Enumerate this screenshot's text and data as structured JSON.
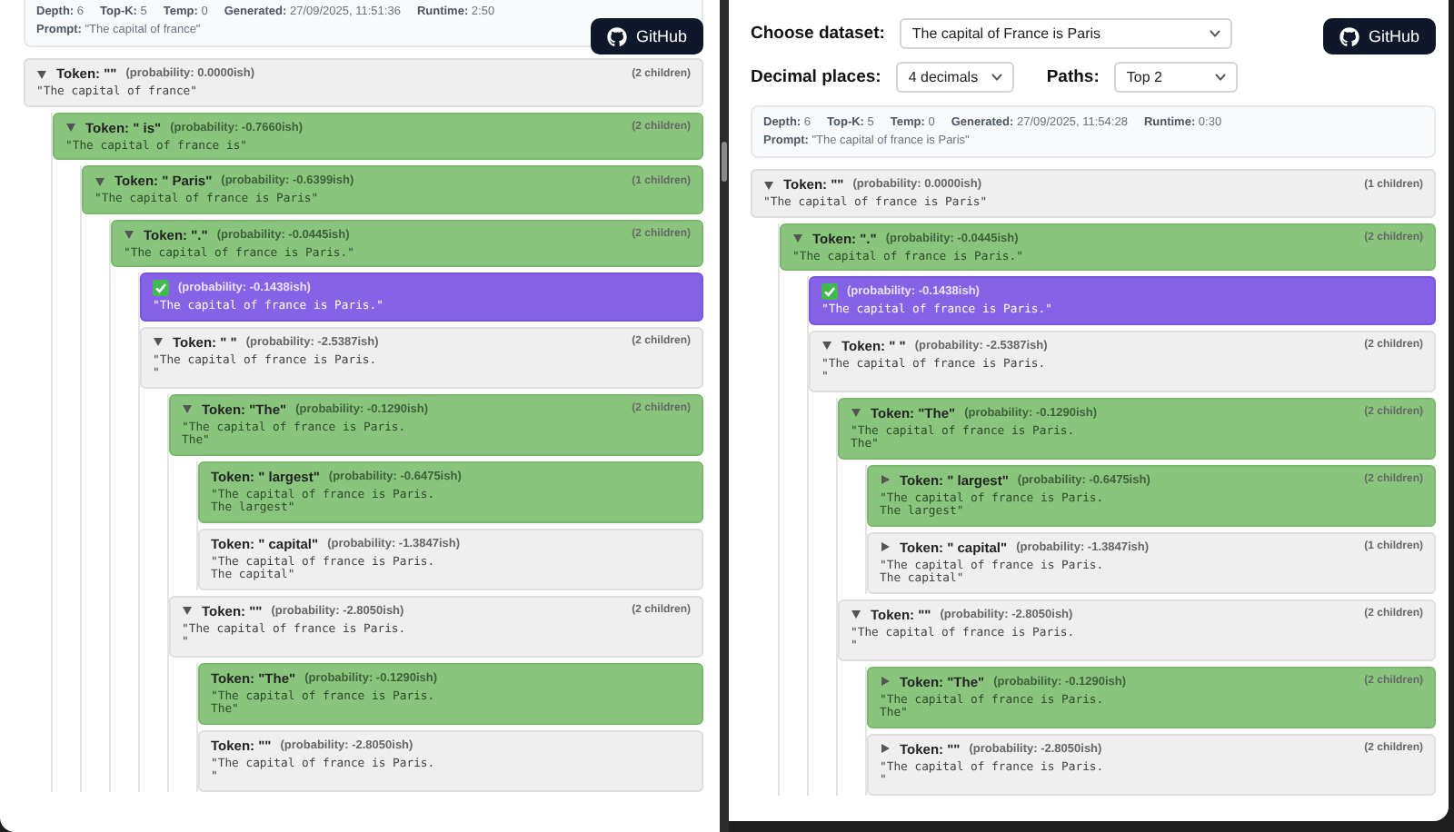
{
  "left": {
    "info": {
      "stats": [
        "**Depth:** 6",
        "**Top-K:** 5",
        "**Temp:** 0",
        "**Generated:** 27/09/2025, 11:51:36",
        "**Runtime:** 2:50"
      ],
      "prompt": "**Prompt:** \"The capital of france\""
    },
    "github_button": "GitHub",
    "tree": {
      "kind": "token",
      "label": "Token: \"\"",
      "probability": "(probability: 0.0000ish)",
      "children_count": "(2 children)",
      "text": "\"The capital of france\"",
      "highlighted": false,
      "expanded": true,
      "children": [
        {
          "kind": "token",
          "label": "Token: \" is\"",
          "probability": "(probability: -0.7660ish)",
          "children_count": "(2 children)",
          "text": "\"The capital of france is\"",
          "highlighted": true,
          "expanded": true,
          "children": [
            {
              "kind": "token",
              "label": "Token: \" Paris\"",
              "probability": "(probability: -0.6399ish)",
              "children_count": "(1 children)",
              "text": "\"The capital of france is Paris\"",
              "highlighted": true,
              "expanded": true,
              "children": [
                {
                  "kind": "token",
                  "label": "Token: \".\"",
                  "probability": "(probability: -0.0445ish)",
                  "children_count": "(2 children)",
                  "text": "\"The capital of france is Paris.\"",
                  "highlighted": true,
                  "expanded": true,
                  "children": [
                    {
                      "kind": "final",
                      "probability": "(probability: -0.1438ish)",
                      "text": "\"The capital of france is Paris.\""
                    },
                    {
                      "kind": "token",
                      "label": "Token: \" \"",
                      "probability": "(probability: -2.5387ish)",
                      "children_count": "(2 children)",
                      "text": "\"The capital of france is Paris.\n\"",
                      "highlighted": false,
                      "expanded": true,
                      "children": [
                        {
                          "kind": "token",
                          "label": "Token: \"The\"",
                          "probability": "(probability: -0.1290ish)",
                          "children_count": "(2 children)",
                          "text": "\"The capital of france is Paris.\nThe\"",
                          "highlighted": true,
                          "expanded": true,
                          "children": [
                            {
                              "kind": "token",
                              "label": "Token: \" largest\"",
                              "probability": "(probability: -0.6475ish)",
                              "text": "\"The capital of france is Paris.\nThe largest\"",
                              "highlighted": true
                            },
                            {
                              "kind": "token",
                              "label": "Token: \" capital\"",
                              "probability": "(probability: -1.3847ish)",
                              "text": "\"The capital of france is Paris.\nThe capital\"",
                              "highlighted": false
                            }
                          ]
                        },
                        {
                          "kind": "token",
                          "label": "Token: \"\"",
                          "probability": "(probability: -2.8050ish)",
                          "children_count": "(2 children)",
                          "text": "\"The capital of france is Paris.\n\"",
                          "highlighted": false,
                          "expanded": true,
                          "children": [
                            {
                              "kind": "token",
                              "label": "Token: \"The\"",
                              "probability": "(probability: -0.1290ish)",
                              "text": "\"The capital of france is Paris.\nThe\"",
                              "highlighted": true
                            },
                            {
                              "kind": "token",
                              "label": "Token: \"\"",
                              "probability": "(probability: -2.8050ish)",
                              "text": "\"The capital of france is Paris.\n\"",
                              "highlighted": false
                            }
                          ]
                        }
                      ]
                    }
                  ]
                }
              ]
            }
          ]
        }
      ]
    }
  },
  "right": {
    "dataset": {
      "label": "Choose dataset:",
      "value": "The capital of France is Paris"
    },
    "decimals": {
      "label": "Decimal places:",
      "value": "4 decimals"
    },
    "paths": {
      "label": "Paths:",
      "value": "Top 2"
    },
    "github_button": "GitHub",
    "info": {
      "stats": [
        "**Depth:** 6",
        "**Top-K:** 5",
        "**Temp:** 0",
        "**Generated:** 27/09/2025, 11:54:28",
        "**Runtime:** 0:30"
      ],
      "prompt": "**Prompt:** \"The capital of france is Paris\""
    },
    "tree": {
      "kind": "token",
      "label": "Token: \"\"",
      "probability": "(probability: 0.0000ish)",
      "children_count": "(1 children)",
      "text": "\"The capital of france is Paris\"",
      "highlighted": false,
      "expanded": true,
      "children": [
        {
          "kind": "token",
          "label": "Token: \".\"",
          "probability": "(probability: -0.0445ish)",
          "children_count": "(2 children)",
          "text": "\"The capital of france is Paris.\"",
          "highlighted": true,
          "expanded": true,
          "children": [
            {
              "kind": "final",
              "probability": "(probability: -0.1438ish)",
              "text": "\"The capital of france is Paris.\""
            },
            {
              "kind": "token",
              "label": "Token: \" \"",
              "probability": "(probability: -2.5387ish)",
              "children_count": "(2 children)",
              "text": "\"The capital of france is Paris.\n\"",
              "highlighted": false,
              "expanded": true,
              "children": [
                {
                  "kind": "token",
                  "label": "Token: \"The\"",
                  "probability": "(probability: -0.1290ish)",
                  "children_count": "(2 children)",
                  "text": "\"The capital of france is Paris.\nThe\"",
                  "highlighted": true,
                  "expanded": true,
                  "children": [
                    {
                      "kind": "token",
                      "label": "Token: \" largest\"",
                      "probability": "(probability: -0.6475ish)",
                      "children_count": "(2 children)",
                      "text": "\"The capital of france is Paris.\nThe largest\"",
                      "highlighted": true,
                      "expanded": false
                    },
                    {
                      "kind": "token",
                      "label": "Token: \" capital\"",
                      "probability": "(probability: -1.3847ish)",
                      "children_count": "(1 children)",
                      "text": "\"The capital of france is Paris.\nThe capital\"",
                      "highlighted": false,
                      "expanded": false
                    }
                  ]
                },
                {
                  "kind": "token",
                  "label": "Token: \"\"",
                  "probability": "(probability: -2.8050ish)",
                  "children_count": "(2 children)",
                  "text": "\"The capital of france is Paris.\n\"",
                  "highlighted": false,
                  "expanded": true,
                  "children": [
                    {
                      "kind": "token",
                      "label": "Token: \"The\"",
                      "probability": "(probability: -0.1290ish)",
                      "children_count": "(2 children)",
                      "text": "\"The capital of france is Paris.\nThe\"",
                      "highlighted": true,
                      "expanded": false
                    },
                    {
                      "kind": "token",
                      "label": "Token: \"\"",
                      "probability": "(probability: -2.8050ish)",
                      "children_count": "(2 children)",
                      "text": "\"The capital of france is Paris.\n\"",
                      "highlighted": false,
                      "expanded": false
                    }
                  ]
                }
              ]
            }
          ]
        }
      ]
    }
  }
}
